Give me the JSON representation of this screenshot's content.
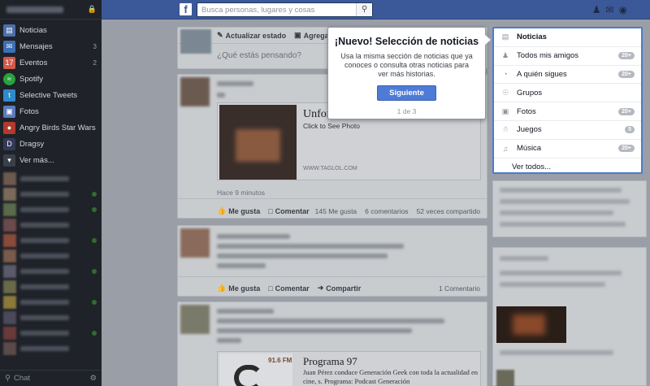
{
  "sidebar": {
    "items": [
      {
        "label": "Noticias",
        "icon": "news-icon",
        "color": "#4e6ea8",
        "count": ""
      },
      {
        "label": "Mensajes",
        "icon": "messages-icon",
        "color": "#3b6fb6",
        "count": "3"
      },
      {
        "label": "Eventos",
        "icon": "calendar-icon",
        "color": "#d35a4a",
        "count": "2"
      },
      {
        "label": "Spotify",
        "icon": "spotify-icon",
        "color": "#2aa13f",
        "count": ""
      },
      {
        "label": "Selective Tweets",
        "icon": "twitter-icon",
        "color": "#2f8ac9",
        "count": ""
      },
      {
        "label": "Fotos",
        "icon": "photos-icon",
        "color": "#5d7bb8",
        "count": ""
      },
      {
        "label": "Angry Birds Star Wars",
        "icon": "game-icon",
        "color": "#b33a2f",
        "count": ""
      },
      {
        "label": "Dragsy",
        "icon": "game-icon",
        "color": "#333a55",
        "count": ""
      },
      {
        "label": "Ver más...",
        "icon": "chevron-down-icon",
        "color": "#3a3f48",
        "count": ""
      }
    ],
    "chat_label": "Chat"
  },
  "topbar": {
    "logo": "f",
    "search_placeholder": "Busca personas, lugares y cosas"
  },
  "composer": {
    "tab_status": "Actualizar estado",
    "tab_photo": "Agregar foto",
    "placeholder": "¿Qué estás pensando?"
  },
  "post1": {
    "link_title": "Unfor",
    "link_sub": "Click to See Photo",
    "domain": "WWW.TAGLOL.COM",
    "time": "Hace 9 minutos",
    "like": "Me gusta",
    "comment": "Comentar",
    "likes_count": "145 Me gusta",
    "comments_count": "6 comentarios",
    "shares_count": "52 veces compartido"
  },
  "post2": {
    "like": "Me gusta",
    "comment": "Comentar",
    "share": "Compartir",
    "comments_count": "1 Comentario"
  },
  "post3": {
    "freq": "91.6 FM",
    "title": "Programa 97",
    "desc": "Juan Pérez conduce Generación Geek con toda la actualidad en cine, s. Programa: Podcast Generación"
  },
  "feed_menu": {
    "items": [
      {
        "label": "Noticias",
        "icon": "news-icon",
        "count": ""
      },
      {
        "label": "Todos mis amigos",
        "icon": "friends-icon",
        "count": "20+"
      },
      {
        "label": "A quién sigues",
        "icon": "rss-icon",
        "count": "20+"
      },
      {
        "label": "Grupos",
        "icon": "groups-icon",
        "count": ""
      },
      {
        "label": "Fotos",
        "icon": "photos-icon",
        "count": "20+"
      },
      {
        "label": "Juegos",
        "icon": "games-icon",
        "count": "5"
      },
      {
        "label": "Música",
        "icon": "music-icon",
        "count": "20+"
      }
    ],
    "see_all": "Ver todos..."
  },
  "popup": {
    "title": "¡Nuevo! Selección de noticias",
    "text": "Usa la misma sección de noticias que ya conoces o consulta otras noticias para ver más historias.",
    "button": "Siguiente",
    "step": "1 de 3"
  },
  "colors": {
    "brand": "#3b5998",
    "highlight_border": "#4a7bd0",
    "button": "#4e7bd6"
  }
}
